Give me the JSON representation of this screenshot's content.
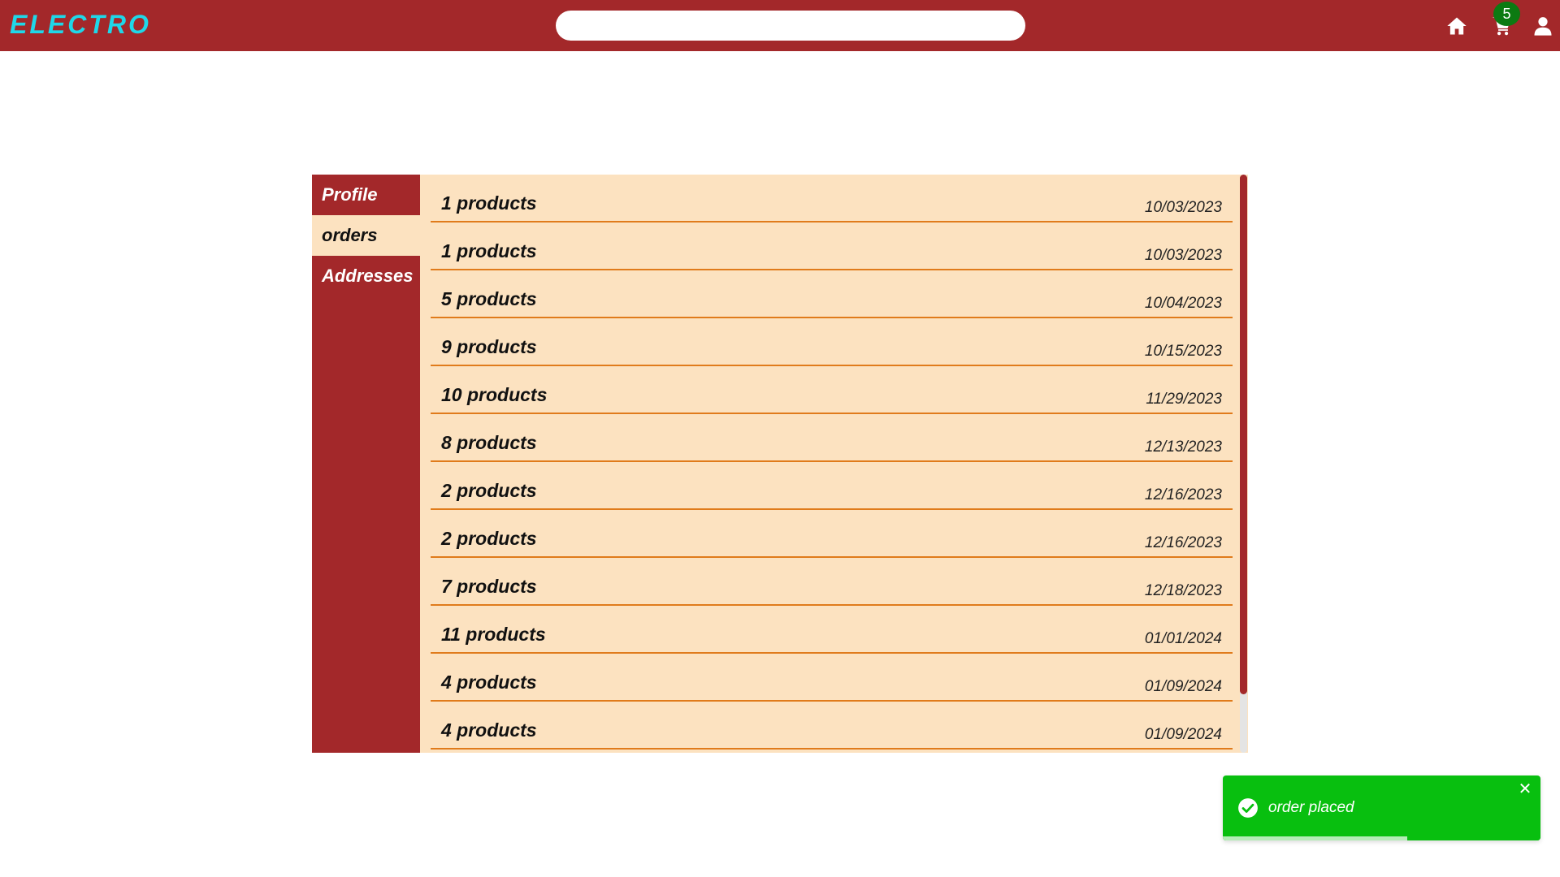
{
  "colors": {
    "brand": "#a3282a",
    "logo": "#1fd7e8",
    "panel_bg": "#fce2c0",
    "row_divider": "#e07b1b",
    "badge": "#0c7a12",
    "toast": "#08bf0f"
  },
  "header": {
    "logo": "ELECTRO",
    "search": {
      "placeholder": "",
      "value": ""
    },
    "icons": [
      "home-icon",
      "cart-icon",
      "user-icon"
    ],
    "cart_count": "5"
  },
  "sidebar": {
    "items": [
      {
        "label": "Profile",
        "active": false
      },
      {
        "label": "orders",
        "active": true
      },
      {
        "label": "Addresses",
        "active": false
      }
    ]
  },
  "orders": [
    {
      "count": "1 products",
      "date": "10/03/2023"
    },
    {
      "count": "1 products",
      "date": "10/03/2023"
    },
    {
      "count": "5 products",
      "date": "10/04/2023"
    },
    {
      "count": "9 products",
      "date": "10/15/2023"
    },
    {
      "count": "10 products",
      "date": "11/29/2023"
    },
    {
      "count": "8 products",
      "date": "12/13/2023"
    },
    {
      "count": "2 products",
      "date": "12/16/2023"
    },
    {
      "count": "2 products",
      "date": "12/16/2023"
    },
    {
      "count": "7 products",
      "date": "12/18/2023"
    },
    {
      "count": "11 products",
      "date": "01/01/2024"
    },
    {
      "count": "4 products",
      "date": "01/09/2024"
    },
    {
      "count": "4 products",
      "date": "01/09/2024"
    }
  ],
  "toast": {
    "message": "order placed",
    "icon": "check-circle-icon",
    "progress": 0.58
  }
}
